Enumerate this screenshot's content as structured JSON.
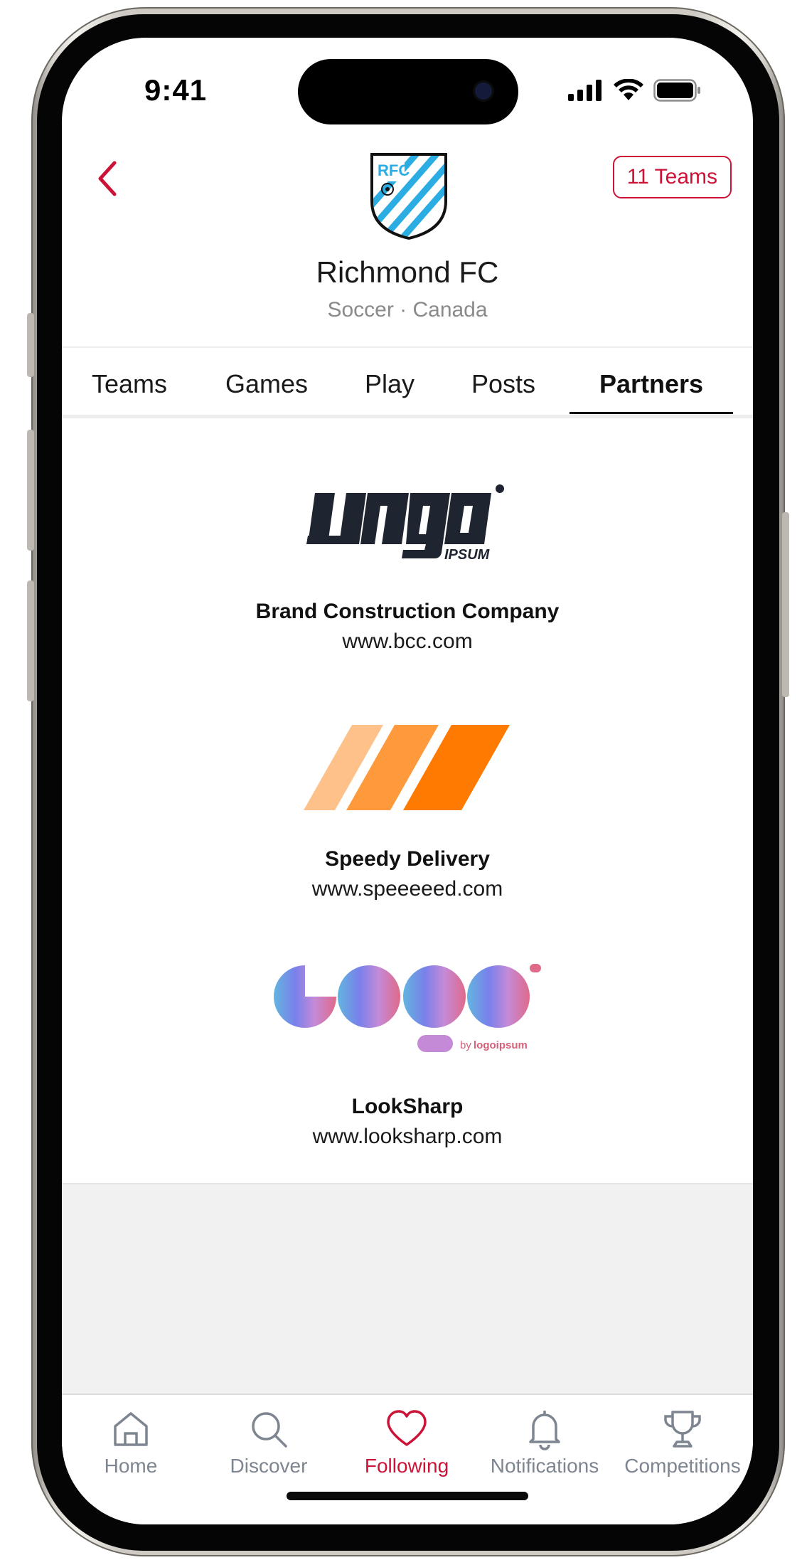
{
  "status_bar": {
    "time": "9:41"
  },
  "header": {
    "back_icon": "chevron-left-icon",
    "crest_text": "RFC",
    "teams_button": "11 Teams",
    "club_name": "Richmond FC",
    "club_meta": "Soccer · Canada"
  },
  "tabs": [
    {
      "label": "Teams"
    },
    {
      "label": "Games"
    },
    {
      "label": "Play"
    },
    {
      "label": "Posts"
    },
    {
      "label": "Partners",
      "active": true
    }
  ],
  "partners": [
    {
      "name": "Brand Construction Company",
      "url": "www.bcc.com",
      "logo": "logo-ipsum-icon",
      "logo_text": "IPSUM"
    },
    {
      "name": "Speedy Delivery",
      "url": "www.speeeeed.com",
      "logo": "orange-stripes-icon"
    },
    {
      "name": "LookSharp",
      "url": "www.looksharp.com",
      "logo": "gradient-circles-icon",
      "logo_text": "logoipsum",
      "logo_prefix": "by"
    }
  ],
  "tabbar": [
    {
      "label": "Home",
      "icon": "house-icon"
    },
    {
      "label": "Discover",
      "icon": "search-icon"
    },
    {
      "label": "Following",
      "icon": "heart-icon",
      "active": true
    },
    {
      "label": "Notifications",
      "icon": "bell-icon"
    },
    {
      "label": "Competitions",
      "icon": "trophy-icon"
    }
  ],
  "colors": {
    "accent": "#cc1237",
    "crest_blue": "#2bace2",
    "orange_dark": "#ff7a00",
    "orange_mid": "#ff9a3c",
    "orange_light": "#ffc18a",
    "muted": "#7d8590"
  }
}
